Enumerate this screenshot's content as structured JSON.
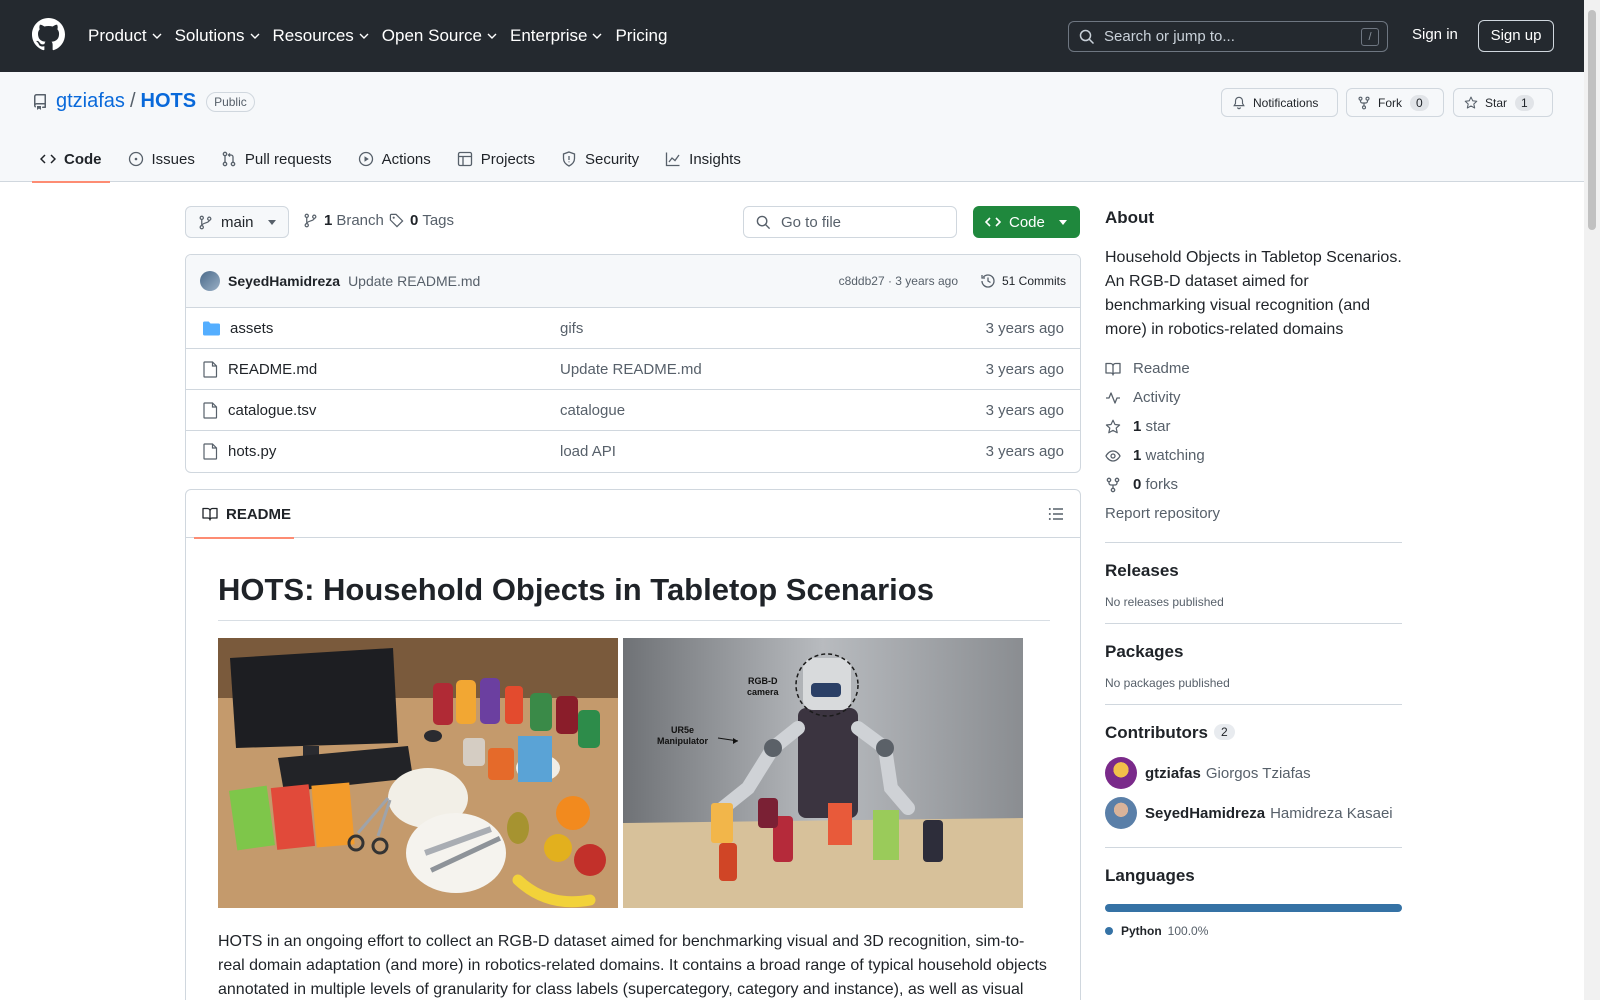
{
  "header": {
    "nav": [
      "Product",
      "Solutions",
      "Resources",
      "Open Source",
      "Enterprise",
      "Pricing"
    ],
    "search_placeholder": "Search or jump to...",
    "search_key": "/",
    "sign_in": "Sign in",
    "sign_up": "Sign up"
  },
  "repo": {
    "owner": "gtziafas",
    "sep": "/",
    "name": "HOTS",
    "visibility": "Public",
    "notifications": "Notifications",
    "fork_label": "Fork",
    "fork_count": "0",
    "star_label": "Star",
    "star_count": "1",
    "tabs": [
      "Code",
      "Issues",
      "Pull requests",
      "Actions",
      "Projects",
      "Security",
      "Insights"
    ]
  },
  "browser": {
    "branch": "main",
    "branch_count": "1",
    "branch_word": "Branch",
    "tag_count": "0",
    "tag_word": "Tags",
    "goto_placeholder": "Go to file",
    "code_button": "Code",
    "commit": {
      "author": "SeyedHamidreza",
      "message": "Update README.md",
      "meta": "c8ddb27 · 3 years ago",
      "commits_link": "51 Commits"
    },
    "files": [
      {
        "name": "assets",
        "type": "folder",
        "message": "gifs",
        "age": "3 years ago"
      },
      {
        "name": "README.md",
        "type": "file",
        "message": "Update README.md",
        "age": "3 years ago"
      },
      {
        "name": "catalogue.tsv",
        "type": "file",
        "message": "catalogue",
        "age": "3 years ago"
      },
      {
        "name": "hots.py",
        "type": "file",
        "message": "load API",
        "age": "3 years ago"
      }
    ]
  },
  "readme": {
    "tab": "README",
    "title": "HOTS: Household Objects in Tabletop Scenarios",
    "image2_label_camera": "RGB-D camera",
    "image2_label_arm": "UR5e Manipulator",
    "paragraph": "HOTS in an ongoing effort to collect an RGB-D dataset aimed for benchmarking visual and 3D recognition, sim-to-real domain adaptation (and more) in robotics-related domains. It contains a broad range of typical household objects annotated in multiple levels of granularity for class labels (supercategory, category and instance), as well as visual"
  },
  "sidebar": {
    "about_title": "About",
    "about_desc": "Household Objects in Tabletop Scenarios. An RGB-D dataset aimed for benchmarking visual recognition (and more) in robotics-related domains",
    "readme_link": "Readme",
    "activity_link": "Activity",
    "stars_count": "1",
    "stars_word": "star",
    "watching_count": "1",
    "watching_word": "watching",
    "forks_count": "0",
    "forks_word": "forks",
    "report": "Report repository",
    "releases_title": "Releases",
    "releases_text": "No releases published",
    "packages_title": "Packages",
    "packages_text": "No packages published",
    "contributors_title": "Contributors",
    "contributors_count": "2",
    "contributors": [
      {
        "login": "gtziafas",
        "name": "Giorgos Tziafas"
      },
      {
        "login": "SeyedHamidreza",
        "name": "Hamidreza Kasaei"
      }
    ],
    "languages_title": "Languages",
    "language": "Python",
    "language_pct": "100.0%",
    "language_fraction": 1.0,
    "language_color": "#3572A5"
  }
}
